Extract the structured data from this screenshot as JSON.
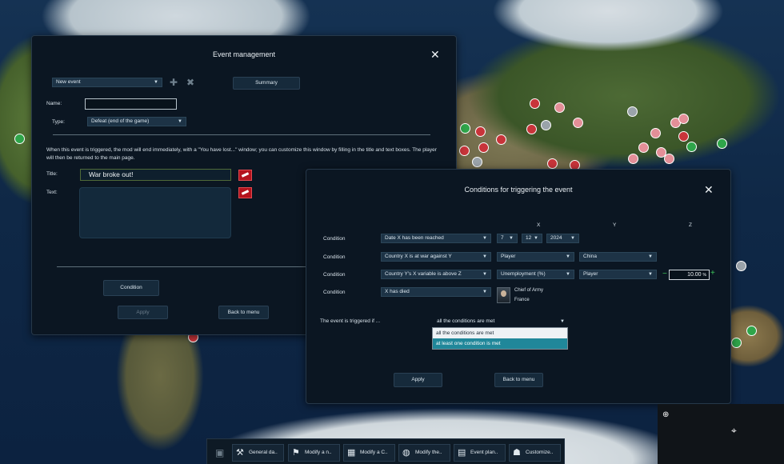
{
  "event_window": {
    "title": "Event management",
    "event_select": "New event",
    "summary_button": "Summary",
    "name_label": "Name:",
    "name_value": "",
    "type_label": "Type:",
    "type_value": "Defeat (end of the game)",
    "description": "When this event is triggered, the mod will end immediately, with a \"You have lost...\" window; you can customize this window by filling in the title and text boxes. The player will then be returned to the main page.",
    "title_label": "Title:",
    "title_value": "War broke out!",
    "text_label": "Text:",
    "text_value": "",
    "condition_button": "Condition",
    "apply_button": "Apply",
    "back_button": "Back to menu"
  },
  "conditions_window": {
    "title": "Conditions for triggering the event",
    "col_x": "X",
    "col_y": "Y",
    "col_z": "Z",
    "rows": [
      {
        "label": "Condition",
        "select": "Date X has been reached",
        "x1": "7",
        "x2": "12",
        "x3": "2024"
      },
      {
        "label": "Condition",
        "select": "Country X is at war against Y",
        "x": "Player",
        "y": "China"
      },
      {
        "label": "Condition",
        "select": "Country Y's X variable is above Z",
        "x": "Unemployment (%)",
        "y": "Player",
        "z_minus": "−",
        "z_value": "10.00",
        "z_unit": "%",
        "z_plus": "+"
      },
      {
        "label": "Condition",
        "select": "X has died",
        "person_role": "Chief of Army",
        "person_country": "France"
      }
    ],
    "trigger_label": "The event is triggered if ...",
    "trigger_value": "all the conditions are met",
    "trigger_options": [
      "all the conditions are met",
      "at least one condition is met"
    ],
    "apply_button": "Apply",
    "back_button": "Back to menu"
  },
  "taskbar": {
    "items": [
      {
        "label": "General da..",
        "icon": "hammer-icon"
      },
      {
        "label": "Modify a n..",
        "icon": "flag-icon"
      },
      {
        "label": "Modify a C..",
        "icon": "building-icon"
      },
      {
        "label": "Modify the..",
        "icon": "globe-icon"
      },
      {
        "label": "Event plan..",
        "icon": "calendar-icon"
      },
      {
        "label": "Customize..",
        "icon": "people-icon"
      }
    ]
  },
  "colors": {
    "panel_bg": "#0b1622",
    "select_bg": "#1d3346",
    "dropdown_active": "#20879a",
    "flag_red": "#b4131d"
  }
}
